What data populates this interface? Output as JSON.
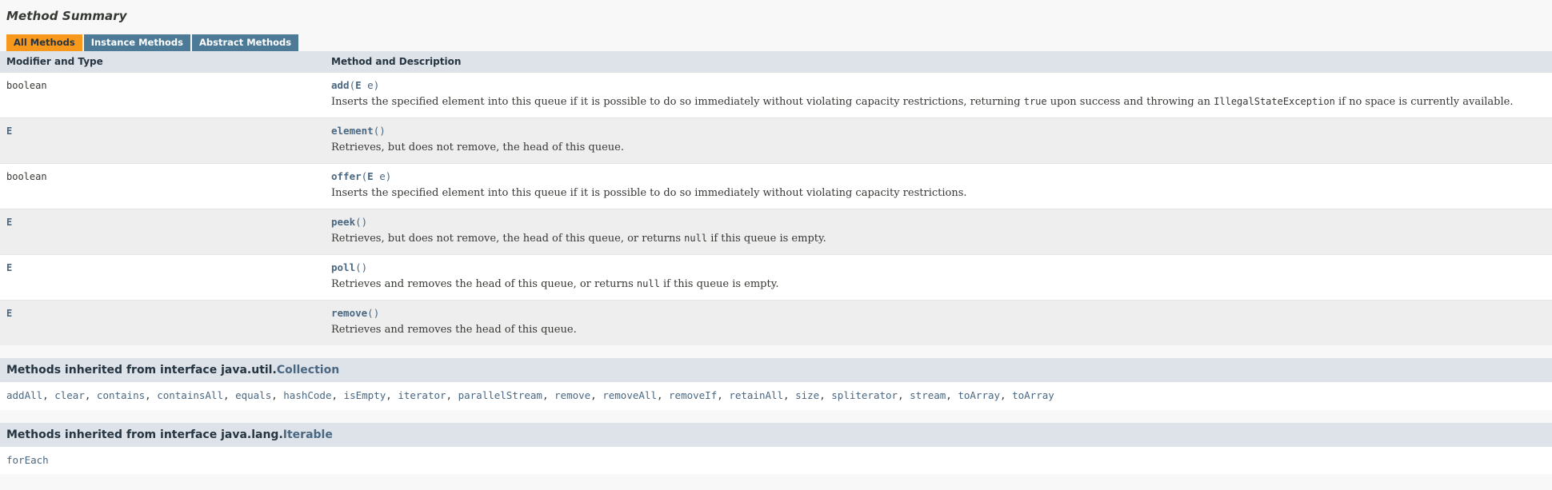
{
  "section": {
    "title": "Method Summary"
  },
  "tabs": [
    {
      "label": "All Methods",
      "active": true
    },
    {
      "label": "Instance Methods",
      "active": false
    },
    {
      "label": "Abstract Methods",
      "active": false
    }
  ],
  "table": {
    "columns": [
      "Modifier and Type",
      "Method and Description"
    ],
    "rows": [
      {
        "modifier": "boolean",
        "modifier_is_type_param": false,
        "method_name": "add",
        "params_open": "(",
        "param_type": "E",
        "param_name": " e",
        "params_close": ")",
        "description_pre": "Inserts the specified element into this queue if it is possible to do so immediately without violating capacity restrictions, returning ",
        "code_1": "true",
        "description_mid": " upon success and throwing an ",
        "code_2": "IllegalStateException",
        "description_post": " if no space is currently available."
      },
      {
        "modifier": "E",
        "modifier_is_type_param": true,
        "method_name": "element",
        "params_open": "(",
        "param_type": "",
        "param_name": "",
        "params_close": ")",
        "description_pre": "Retrieves, but does not remove, the head of this queue.",
        "code_1": "",
        "description_mid": "",
        "code_2": "",
        "description_post": ""
      },
      {
        "modifier": "boolean",
        "modifier_is_type_param": false,
        "method_name": "offer",
        "params_open": "(",
        "param_type": "E",
        "param_name": " e",
        "params_close": ")",
        "description_pre": "Inserts the specified element into this queue if it is possible to do so immediately without violating capacity restrictions.",
        "code_1": "",
        "description_mid": "",
        "code_2": "",
        "description_post": ""
      },
      {
        "modifier": "E",
        "modifier_is_type_param": true,
        "method_name": "peek",
        "params_open": "(",
        "param_type": "",
        "param_name": "",
        "params_close": ")",
        "description_pre": "Retrieves, but does not remove, the head of this queue, or returns ",
        "code_1": "null",
        "description_mid": " if this queue is empty.",
        "code_2": "",
        "description_post": ""
      },
      {
        "modifier": "E",
        "modifier_is_type_param": true,
        "method_name": "poll",
        "params_open": "(",
        "param_type": "",
        "param_name": "",
        "params_close": ")",
        "description_pre": "Retrieves and removes the head of this queue, or returns ",
        "code_1": "null",
        "description_mid": " if this queue is empty.",
        "code_2": "",
        "description_post": ""
      },
      {
        "modifier": "E",
        "modifier_is_type_param": true,
        "method_name": "remove",
        "params_open": "(",
        "param_type": "",
        "param_name": "",
        "params_close": ")",
        "description_pre": "Retrieves and removes the head of this queue.",
        "code_1": "",
        "description_mid": "",
        "code_2": "",
        "description_post": ""
      }
    ]
  },
  "inherited": [
    {
      "header_prefix": "Methods inherited from interface java.util.",
      "header_interface": "Collection",
      "methods": [
        "addAll",
        "clear",
        "contains",
        "containsAll",
        "equals",
        "hashCode",
        "isEmpty",
        "iterator",
        "parallelStream",
        "remove",
        "removeAll",
        "removeIf",
        "retainAll",
        "size",
        "spliterator",
        "stream",
        "toArray",
        "toArray"
      ]
    },
    {
      "header_prefix": "Methods inherited from interface java.lang.",
      "header_interface": "Iterable",
      "methods": [
        "forEach"
      ]
    }
  ],
  "colors": {
    "tab_active": "#F8981D",
    "tab_inactive": "#4D7A97",
    "header_bg": "#DEE3E9",
    "link": "#4A6782",
    "alt_row": "#EEEEEF",
    "page_bg": "#F8F8F8"
  }
}
